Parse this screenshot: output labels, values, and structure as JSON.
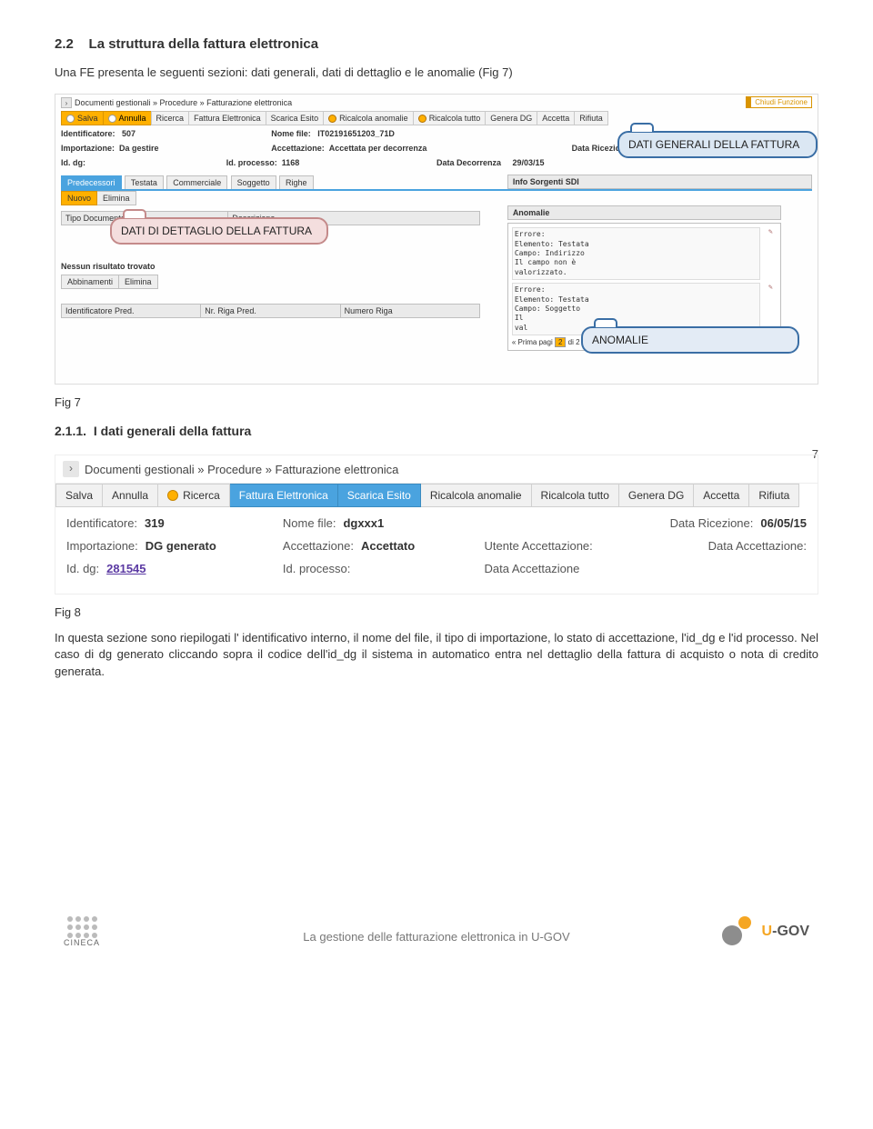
{
  "section": {
    "num_title": "2.2",
    "title": "La struttura della fattura elettronica",
    "intro": "Una FE presenta le seguenti sezioni: dati generali, dati di dettaglio e le anomalie (Fig 7)"
  },
  "fig7": {
    "breadcrumb": "Documenti gestionali » Procedure » Fatturazione elettronica",
    "close_fn": "Chiudi Funzione",
    "toolbar": {
      "salva": "Salva",
      "annulla": "Annulla",
      "ricerca": "Ricerca",
      "fattura_el": "Fattura Elettronica",
      "scarica_esito": "Scarica Esito",
      "ricalcola_anom": "Ricalcola anomalie",
      "ricalcola_tutto": "Ricalcola tutto",
      "genera_dg": "Genera DG",
      "accetta": "Accetta",
      "rifiuta": "Rifiuta"
    },
    "fields": {
      "identificatore_lbl": "Identificatore:",
      "identificatore_val": "507",
      "nome_file_lbl": "Nome file:",
      "nome_file_val": "IT02191651203_71D",
      "importazione_lbl": "Importazione:",
      "importazione_val": "Da gestire",
      "accettazione_lbl": "Accettazione:",
      "accettazione_val": "Accettata per decorrenza",
      "data_ric_lbl": "Data Ricezione:",
      "id_dg_lbl": "Id. dg:",
      "id_processo_lbl": "Id. processo:",
      "id_processo_val": "1168",
      "data_dec_lbl": "Data Decorrenza",
      "data_dec_val": "29/03/15"
    },
    "tabs": {
      "predecessori": "Predecessori",
      "testata": "Testata",
      "commerciale": "Commerciale",
      "soggetto": "Soggetto",
      "righe": "Righe"
    },
    "smallbtn": {
      "nuovo": "Nuovo",
      "elimina": "Elimina",
      "abbinamenti": "Abbinamenti"
    },
    "gridhead": {
      "tipo_doc": "Tipo Documento",
      "descrizione": "Descrizione"
    },
    "no_result": "Nessun risultato trovato",
    "gridhead2": {
      "id_pred": "Identificatore Pred.",
      "nr_riga_pred": "Nr. Riga Pred.",
      "numero_riga": "Numero Riga"
    },
    "info_sdi": "Info Sorgenti SDI",
    "anomalie_head": "Anomalie",
    "err_ico": "✎",
    "err1": "Errore:\nElemento: Testata\nCampo: Indirizzo\nIl campo non è\nvalorizzato.",
    "err2": "Errore:\nElemento: Testata\nCampo: Soggetto\nIl\nval",
    "pagination": {
      "prefix": "Prima pagi",
      "cur": "2",
      "suffix": "di 2"
    }
  },
  "callouts": {
    "c1": "DATI GENERALI DELLA FATTURA",
    "c2": "DATI DI DETTAGLIO DELLA FATTURA",
    "c3": "ANOMALIE"
  },
  "fig7_caption": "Fig 7",
  "subsection": {
    "num": "2.1.1.",
    "title": "I dati generali della fattura"
  },
  "page_num": "7",
  "fig8": {
    "breadcrumb": "Documenti gestionali » Procedure » Fatturazione elettronica",
    "toolbar": {
      "salva": "Salva",
      "annulla": "Annulla",
      "ricerca": "Ricerca",
      "fattura_el": "Fattura Elettronica",
      "scarica_esito": "Scarica Esito",
      "ricalcola_anom": "Ricalcola anomalie",
      "ricalcola_tutto": "Ricalcola tutto",
      "genera_dg": "Genera DG",
      "accetta": "Accetta",
      "rifiuta": "Rifiuta"
    },
    "row1": {
      "identificatore_lbl": "Identificatore:",
      "identificatore_val": "319",
      "nome_file_lbl": "Nome file:",
      "nome_file_val": "dgxxx1",
      "data_ric_lbl": "Data Ricezione:",
      "data_ric_val": "06/05/15"
    },
    "row2": {
      "importazione_lbl": "Importazione:",
      "importazione_val": "DG generato",
      "accettazione_lbl": "Accettazione:",
      "accettazione_val": "Accettato",
      "utente_acc_lbl": "Utente Accettazione:",
      "data_acc_lbl": "Data Accettazione:"
    },
    "row3": {
      "id_dg_lbl": "Id. dg:",
      "id_dg_val": "281545",
      "id_processo_lbl": "Id. processo:",
      "data_acc_lbl": "Data Accettazione"
    }
  },
  "fig8_caption": "Fig 8",
  "body_para": "In questa sezione sono riepilogati l' identificativo interno, il nome del file, il tipo di importazione, lo stato di accettazione, l'id_dg e l'id processo. Nel caso di dg generato cliccando sopra il codice dell'id_dg il sistema in automatico entra nel dettaglio della fattura di acquisto o nota di credito generata.",
  "footer": {
    "cineca": "CINECA",
    "title": "La gestione delle fatturazione elettronica in U-GOV",
    "ugov_u": "U",
    "ugov_rest": "-GOV"
  }
}
